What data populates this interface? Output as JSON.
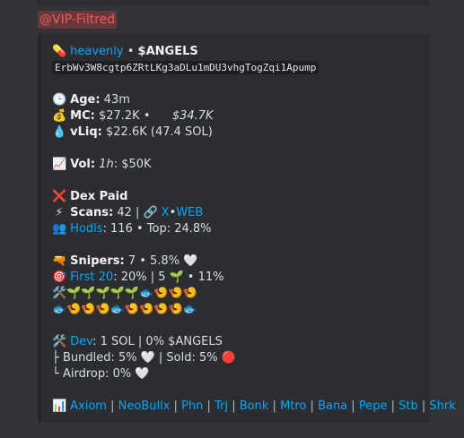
{
  "mention": "@VIP-Filtred",
  "token": {
    "source": "heavenly",
    "dot": "•",
    "symbol": "$ANGELS",
    "address": "ErbWv3W8cgtp6ZRtLKg3aDLu1mDU3vhgTogZqi1Apump"
  },
  "age": {
    "icon": "🕒",
    "label": "Age:",
    "value": "43m"
  },
  "mc": {
    "icon": "💰",
    "label": "MC:",
    "value": "$27.2K",
    "dot": "•",
    "ath": "$34.7K"
  },
  "liq": {
    "icon": "💧",
    "label": "vLiq:",
    "value": "$22.6K (47.4 SOL)"
  },
  "vol": {
    "icon": "📈",
    "label": "Vol:",
    "period": "1h",
    "value": ": $50K"
  },
  "dex": {
    "icon": "❌",
    "label": "Dex Paid"
  },
  "scans": {
    "icon": "⚡",
    "label": "Scans:",
    "value": "42 |",
    "link_icon": "🔗",
    "x": "X",
    "dot": "•",
    "web": "WEB"
  },
  "hodls": {
    "icon": "👥",
    "link": "Hodls",
    "value": ": 116 • Top: 24.8%"
  },
  "snipers": {
    "icon": "🔫",
    "label": "Snipers:",
    "value": "7 • 5.8%",
    "heart": "🤍"
  },
  "first20": {
    "icon": "🎯",
    "link": "First 20",
    "value": ": 20% | 5",
    "sprout": "🌱",
    "rest": "• 11%"
  },
  "emoji_rows": [
    "🛠️🌱🌱🌱🌱🌱🐟🍤🍤🍤",
    "🐟🍤🍤🍤🐟🍤🍤🍤🍤🐟"
  ],
  "dev": {
    "icon": "🛠️",
    "link": "Dev",
    "value": ": 1 SOL | 0% $ANGELS"
  },
  "bundled": {
    "prefix": "├ Bundled: 5%",
    "heart": "🤍",
    "mid": "| Sold: 5%",
    "dot": "🔴"
  },
  "airdrop": {
    "prefix": "└ Airdrop: 0%",
    "heart": "🤍"
  },
  "links": {
    "icon": "📊",
    "items": [
      "Axiom",
      "NeoBullx",
      "Phn",
      "Trj",
      "Bonk",
      "Mtro",
      "Bana",
      "Pepe",
      "Stb",
      "Shrk"
    ],
    "sep": "|"
  }
}
